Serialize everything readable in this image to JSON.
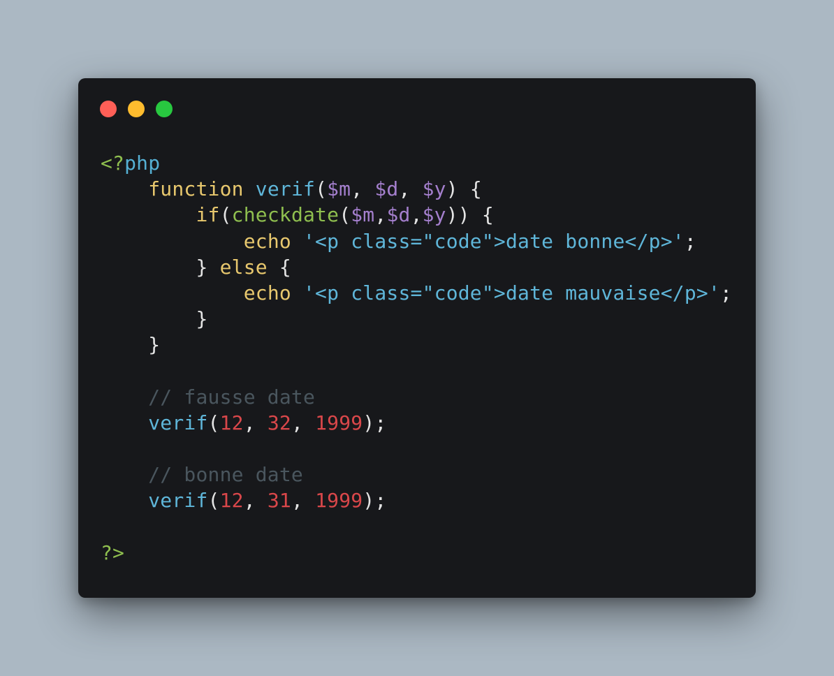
{
  "window": {
    "buttons": [
      {
        "name": "close",
        "color": "#ff5f57"
      },
      {
        "name": "minimize",
        "color": "#febc2e"
      },
      {
        "name": "maximize",
        "color": "#28c840"
      }
    ]
  },
  "code": {
    "lines": [
      [
        {
          "t": "<?",
          "k": "meta"
        },
        {
          "t": "php",
          "k": "php"
        }
      ],
      [
        {
          "t": "    ",
          "k": "punc"
        },
        {
          "t": "function",
          "k": "kw"
        },
        {
          "t": " ",
          "k": "punc"
        },
        {
          "t": "verif",
          "k": "fn"
        },
        {
          "t": "(",
          "k": "punc"
        },
        {
          "t": "$m",
          "k": "var"
        },
        {
          "t": ", ",
          "k": "punc"
        },
        {
          "t": "$d",
          "k": "var"
        },
        {
          "t": ", ",
          "k": "punc"
        },
        {
          "t": "$y",
          "k": "var"
        },
        {
          "t": ") {",
          "k": "punc"
        }
      ],
      [
        {
          "t": "        ",
          "k": "punc"
        },
        {
          "t": "if",
          "k": "kw"
        },
        {
          "t": "(",
          "k": "punc"
        },
        {
          "t": "checkdate",
          "k": "builtin"
        },
        {
          "t": "(",
          "k": "punc"
        },
        {
          "t": "$m",
          "k": "var"
        },
        {
          "t": ",",
          "k": "punc"
        },
        {
          "t": "$d",
          "k": "var"
        },
        {
          "t": ",",
          "k": "punc"
        },
        {
          "t": "$y",
          "k": "var"
        },
        {
          "t": ")) {",
          "k": "punc"
        }
      ],
      [
        {
          "t": "            ",
          "k": "punc"
        },
        {
          "t": "echo",
          "k": "kw"
        },
        {
          "t": " ",
          "k": "punc"
        },
        {
          "t": "'<p class=\"code\">date bonne</p>'",
          "k": "str"
        },
        {
          "t": ";",
          "k": "punc"
        }
      ],
      [
        {
          "t": "        } ",
          "k": "punc"
        },
        {
          "t": "else",
          "k": "kw"
        },
        {
          "t": " {",
          "k": "punc"
        }
      ],
      [
        {
          "t": "            ",
          "k": "punc"
        },
        {
          "t": "echo",
          "k": "kw"
        },
        {
          "t": " ",
          "k": "punc"
        },
        {
          "t": "'<p class=\"code\">date mauvaise</p>'",
          "k": "str"
        },
        {
          "t": ";",
          "k": "punc"
        }
      ],
      [
        {
          "t": "        }",
          "k": "punc"
        }
      ],
      [
        {
          "t": "    }",
          "k": "punc"
        }
      ],
      [],
      [
        {
          "t": "    ",
          "k": "punc"
        },
        {
          "t": "// fausse date",
          "k": "cmt"
        }
      ],
      [
        {
          "t": "    ",
          "k": "punc"
        },
        {
          "t": "verif",
          "k": "fn"
        },
        {
          "t": "(",
          "k": "punc"
        },
        {
          "t": "12",
          "k": "num"
        },
        {
          "t": ", ",
          "k": "punc"
        },
        {
          "t": "32",
          "k": "num"
        },
        {
          "t": ", ",
          "k": "punc"
        },
        {
          "t": "1999",
          "k": "num"
        },
        {
          "t": ");",
          "k": "punc"
        }
      ],
      [],
      [
        {
          "t": "    ",
          "k": "punc"
        },
        {
          "t": "// bonne date",
          "k": "cmt"
        }
      ],
      [
        {
          "t": "    ",
          "k": "punc"
        },
        {
          "t": "verif",
          "k": "fn"
        },
        {
          "t": "(",
          "k": "punc"
        },
        {
          "t": "12",
          "k": "num"
        },
        {
          "t": ", ",
          "k": "punc"
        },
        {
          "t": "31",
          "k": "num"
        },
        {
          "t": ", ",
          "k": "punc"
        },
        {
          "t": "1999",
          "k": "num"
        },
        {
          "t": ");",
          "k": "punc"
        }
      ],
      [],
      [
        {
          "t": "?>",
          "k": "meta"
        }
      ]
    ]
  }
}
